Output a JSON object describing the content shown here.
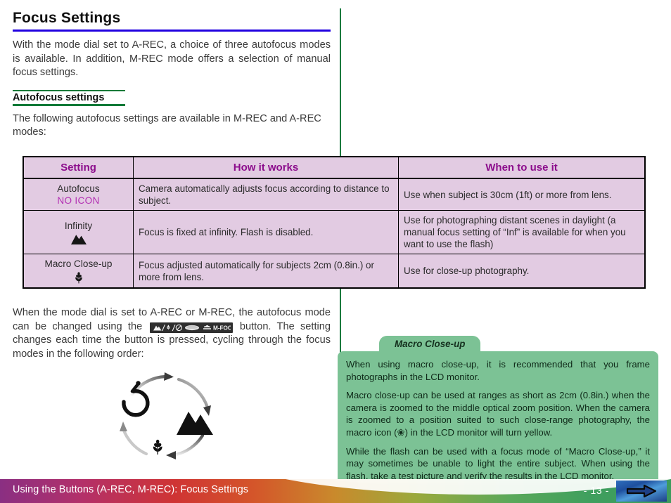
{
  "document": {
    "title": "Focus Settings",
    "intro": "With the mode dial set to A-REC, a choice of three autofocus modes is available.  In addition, M-REC mode offers a selection of manual focus settings.",
    "subhead": "Autofocus settings",
    "subintro": "The following autofocus settings are available in M-REC and A-REC modes:",
    "after_table_1": "When the mode dial is set to A-REC or M-REC, the autofocus mode can be changed using the",
    "after_table_2": "button.  The setting changes each time the button is pressed, cycling through the focus modes in the following order:"
  },
  "table": {
    "headers": [
      "Setting",
      "How it works",
      "When to use it"
    ],
    "rows": [
      {
        "setting": "Autofocus",
        "setting_icon": "none",
        "setting_icon_label": "NO ICON",
        "how": "Camera automatically adjusts focus according to distance to subject.",
        "when": "Use when subject is 30cm (1ft) or more from lens."
      },
      {
        "setting": "Infinity",
        "setting_icon": "mountain-icon",
        "setting_icon_label": "",
        "how": "Focus is fixed at infinity.  Flash is disabled.",
        "when": "Use for photographing distant scenes in daylight (a manual focus setting of “Inf” is available for when you want to use the flash)"
      },
      {
        "setting": "Macro Close-up",
        "setting_icon": "flower-icon",
        "setting_icon_label": "",
        "how": "Focus adjusted automatically for subjects 2cm (0.8in.) or more from lens.",
        "when": "Use for close-up photography."
      }
    ]
  },
  "inline_button": {
    "label": "M-FOCUS",
    "icons": [
      "mountain-icon",
      "flower-icon",
      "no-flash-icon",
      "oval-icon",
      "macro-bar-icon"
    ]
  },
  "cycle_diagram": {
    "steps": [
      "autofocus-clock-icon",
      "mountain-icon",
      "flower-icon"
    ]
  },
  "callout": {
    "tab_label": "Macro Close-up",
    "paragraphs": [
      "When using macro close-up, it is recommended that you frame photographs in the LCD monitor.",
      "Macro close-up can be used at ranges as short as 2cm (0.8in.) when the camera is zoomed to the middle optical zoom position.  When the camera is zoomed to a position suited to such close-range photography, the macro icon (❀) in the LCD monitor will turn yellow.",
      "While the flash can be used with a focus mode of “Macro Close-up,” it may sometimes be unable to light the entire subject.  When using the flash, take a test picture and verify the results in the LCD monitor."
    ]
  },
  "footer": {
    "breadcrumb": "Using the Buttons (A-REC, M-REC): Focus Settings",
    "page": "- 13 -",
    "next_icon": "arrow-right-icon"
  },
  "colors": {
    "title_rule": "#2000e0",
    "subhead_rule": "#0a7a38",
    "column_rule": "#117a3d",
    "table_bg": "#e2cbe2",
    "table_header_text": "#8c0d8c",
    "no_icon_text": "#b32fb3",
    "callout_bg": "#7cc295",
    "next_button": "#2f6fbe"
  }
}
